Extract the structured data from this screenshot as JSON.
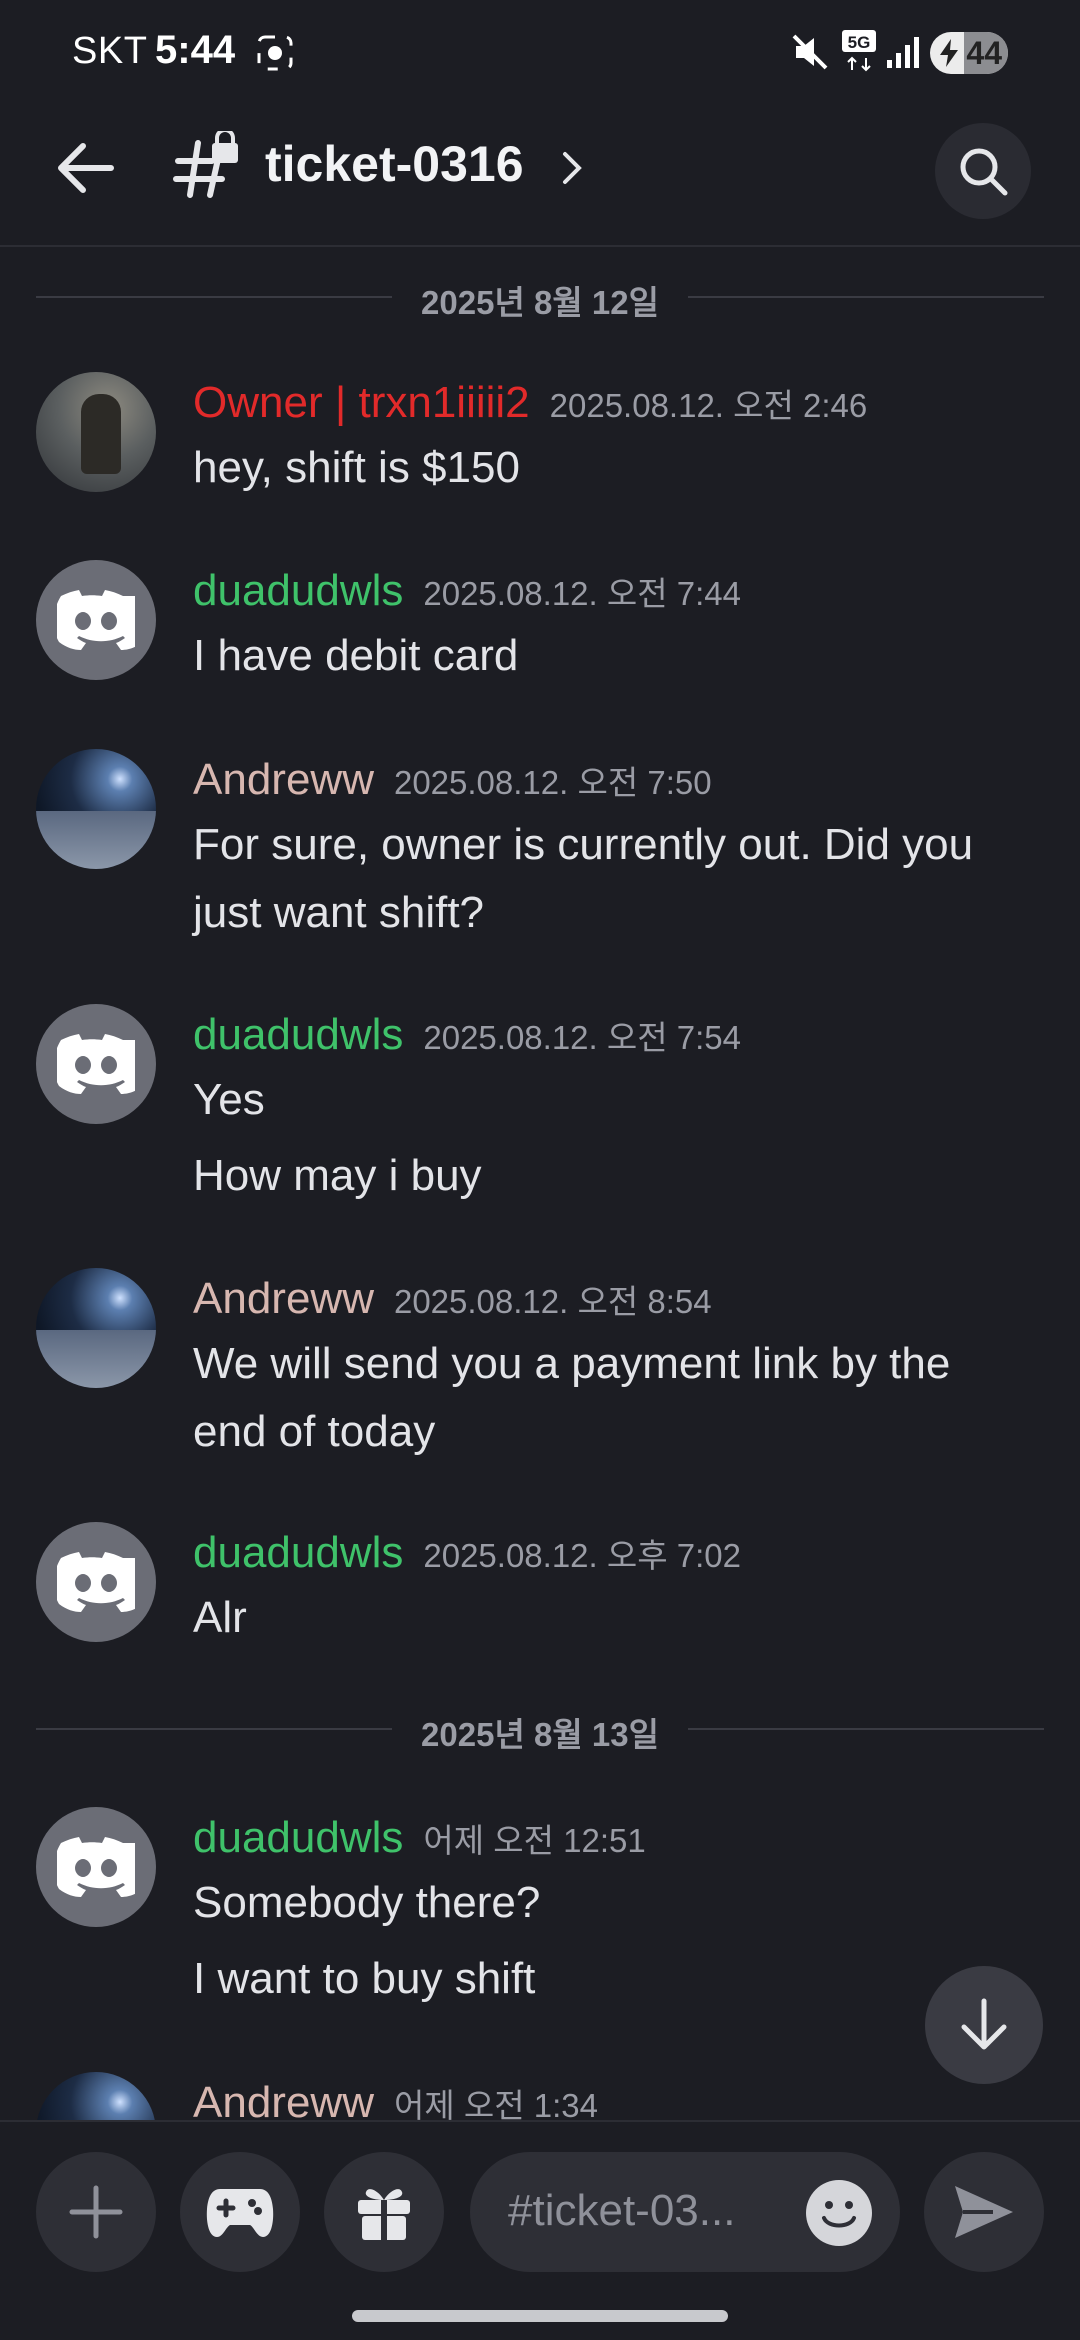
{
  "status_bar": {
    "carrier": "SKT",
    "time": "5:44",
    "network": "5G",
    "battery": "44",
    "battery_level": 0.44
  },
  "header": {
    "channel_name": "ticket-0316"
  },
  "dividers": {
    "d1": "2025년 8월 12일",
    "d2": "2025년 8월 13일"
  },
  "messages": [
    {
      "author": "Owner | trxn1iiiii2",
      "author_color": "#e22a2a",
      "timestamp": "2025.08.12. 오전 2:46",
      "lines": [
        "hey, shift is $150"
      ]
    },
    {
      "author": "duadudwls",
      "author_color": "#3fc26a",
      "timestamp": "2025.08.12. 오전 7:44",
      "lines": [
        "I have debit card"
      ]
    },
    {
      "author": "Andreww",
      "author_color": "#d7b7b0",
      "timestamp": "2025.08.12. 오전 7:50",
      "lines": [
        "For sure, owner is currently out. Did you",
        "just want shift?"
      ]
    },
    {
      "author": "duadudwls",
      "author_color": "#3fc26a",
      "timestamp": "2025.08.12. 오전 7:54",
      "lines": [
        "Yes",
        "How may i buy"
      ]
    },
    {
      "author": "Andreww",
      "author_color": "#d7b7b0",
      "timestamp": "2025.08.12. 오전 8:54",
      "lines": [
        "We will send you a payment link by the",
        "end of today"
      ]
    },
    {
      "author": "duadudwls",
      "author_color": "#3fc26a",
      "timestamp": "2025.08.12. 오후 7:02",
      "lines": [
        "Alr"
      ]
    },
    {
      "author": "duadudwls",
      "author_color": "#3fc26a",
      "timestamp": "어제 오전 12:51",
      "lines": [
        "Somebody there?",
        "I want to buy shift"
      ]
    },
    {
      "author": "Andreww",
      "author_color": "#d7b7b0",
      "timestamp": "어제 오전 1:34",
      "lines": []
    }
  ],
  "composer": {
    "placeholder": "#ticket-03..."
  },
  "icons": {
    "back": "arrow-left-icon",
    "channel": "hash-lock-icon",
    "search": "search-icon",
    "add": "plus-icon",
    "games": "gamepad-icon",
    "gift": "gift-icon",
    "emoji": "smiley-icon",
    "send": "send-icon",
    "jump": "arrow-down-icon"
  }
}
